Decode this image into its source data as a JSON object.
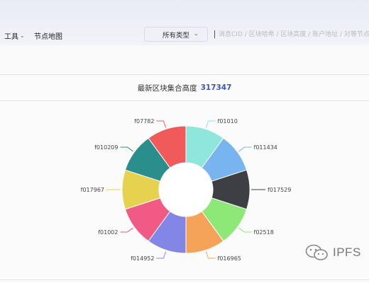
{
  "nav": {
    "tools_label": "工具",
    "node_map_label": "节点地图",
    "type_select_value": "所有类型",
    "search_placeholder": "消息CID / 区块哈希 / 区块高度 / 账户地址 / 对等节点"
  },
  "card": {
    "title": "最新区块集合高度",
    "height_value": "317347"
  },
  "chart_data": {
    "type": "pie",
    "donut": true,
    "categories": [
      "f01010",
      "f011434",
      "f017529",
      "f02518",
      "f016965",
      "f014952",
      "f01002",
      "f017967",
      "f010209",
      "f07782"
    ],
    "values": [
      1,
      1,
      1,
      1,
      1,
      1,
      1,
      1,
      1,
      1
    ],
    "colors": [
      "#8ee6dc",
      "#78b4ef",
      "#3e3e45",
      "#8ee878",
      "#f6a35a",
      "#8486e6",
      "#f05a84",
      "#e6d24e",
      "#2a8f8c",
      "#f15a5a"
    ]
  },
  "watermark": {
    "text": "IPFS"
  }
}
